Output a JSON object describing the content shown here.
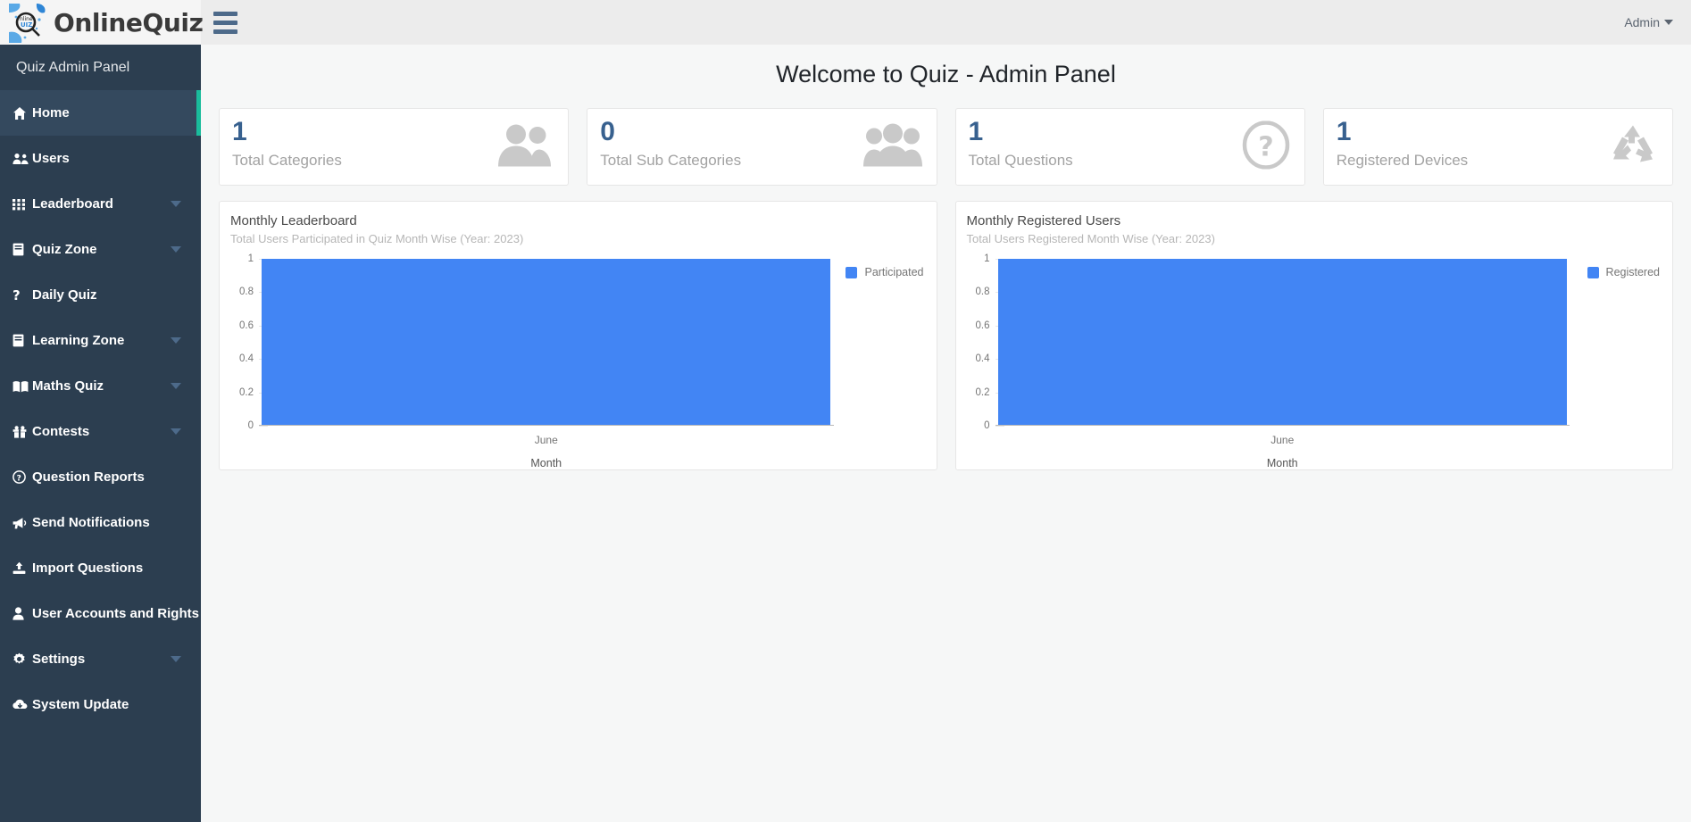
{
  "topbar": {
    "brand": "OnlineQuiz",
    "logo_icon": "quiz-logo-icon",
    "menu_toggle_icon": "hamburger-icon",
    "admin_label": "Admin",
    "admin_caret_icon": "chevron-down-icon"
  },
  "sidebar": {
    "header": "Quiz Admin Panel",
    "accent_color": "#1abc9c",
    "background_color": "#2c3e50",
    "items": [
      {
        "label": "Home",
        "icon": "home-icon",
        "active": true,
        "has_caret": false
      },
      {
        "label": "Users",
        "icon": "users-icon",
        "active": false,
        "has_caret": false
      },
      {
        "label": "Leaderboard",
        "icon": "grid-icon",
        "active": false,
        "has_caret": true
      },
      {
        "label": "Quiz Zone",
        "icon": "book-icon",
        "active": false,
        "has_caret": true
      },
      {
        "label": "Daily Quiz",
        "icon": "question-mark-icon",
        "active": false,
        "has_caret": false
      },
      {
        "label": "Learning Zone",
        "icon": "book-icon",
        "active": false,
        "has_caret": true
      },
      {
        "label": "Maths Quiz",
        "icon": "open-book-icon",
        "active": false,
        "has_caret": true
      },
      {
        "label": "Contests",
        "icon": "gift-icon",
        "active": false,
        "has_caret": true
      },
      {
        "label": "Question Reports",
        "icon": "help-circle-icon",
        "active": false,
        "has_caret": false
      },
      {
        "label": "Send Notifications",
        "icon": "bullhorn-icon",
        "active": false,
        "has_caret": false
      },
      {
        "label": "Import Questions",
        "icon": "upload-icon",
        "active": false,
        "has_caret": false
      },
      {
        "label": "User Accounts and Rights",
        "icon": "user-icon",
        "active": false,
        "has_caret": false
      },
      {
        "label": "Settings",
        "icon": "gear-icon",
        "active": false,
        "has_caret": true
      },
      {
        "label": "System Update",
        "icon": "cloud-download-icon",
        "active": false,
        "has_caret": false
      }
    ]
  },
  "main": {
    "page_title": "Welcome to Quiz - Admin Panel",
    "stat_value_color": "#38618f",
    "stats": [
      {
        "value": "1",
        "label": "Total Categories",
        "icon": "two-users-icon"
      },
      {
        "value": "0",
        "label": "Total Sub Categories",
        "icon": "three-users-icon"
      },
      {
        "value": "1",
        "label": "Total Questions",
        "icon": "question-circle-icon"
      },
      {
        "value": "1",
        "label": "Registered Devices",
        "icon": "recycle-icon"
      }
    ]
  },
  "chart_data": [
    {
      "type": "bar",
      "title": "Monthly Leaderboard",
      "subtitle": "Total Users Participated in Quiz Month Wise (Year: 2023)",
      "categories": [
        "June"
      ],
      "values": [
        1
      ],
      "series": [
        {
          "name": "Participated",
          "values": [
            1
          ]
        }
      ],
      "legend": [
        "Participated"
      ],
      "legend_position": "right",
      "bar_color": "#4285f4",
      "xlabel": "Month",
      "ylabel": "",
      "ylim": [
        0,
        1
      ],
      "yticks": [
        "1",
        "0.8",
        "0.6",
        "0.4",
        "0.2",
        "0"
      ],
      "grid": false
    },
    {
      "type": "bar",
      "title": "Monthly Registered Users",
      "subtitle": "Total Users Registered Month Wise (Year: 2023)",
      "categories": [
        "June"
      ],
      "values": [
        1
      ],
      "series": [
        {
          "name": "Registered",
          "values": [
            1
          ]
        }
      ],
      "legend": [
        "Registered"
      ],
      "legend_position": "right",
      "bar_color": "#4285f4",
      "xlabel": "Month",
      "ylabel": "",
      "ylim": [
        0,
        1
      ],
      "yticks": [
        "1",
        "0.8",
        "0.6",
        "0.4",
        "0.2",
        "0"
      ],
      "grid": false
    }
  ]
}
